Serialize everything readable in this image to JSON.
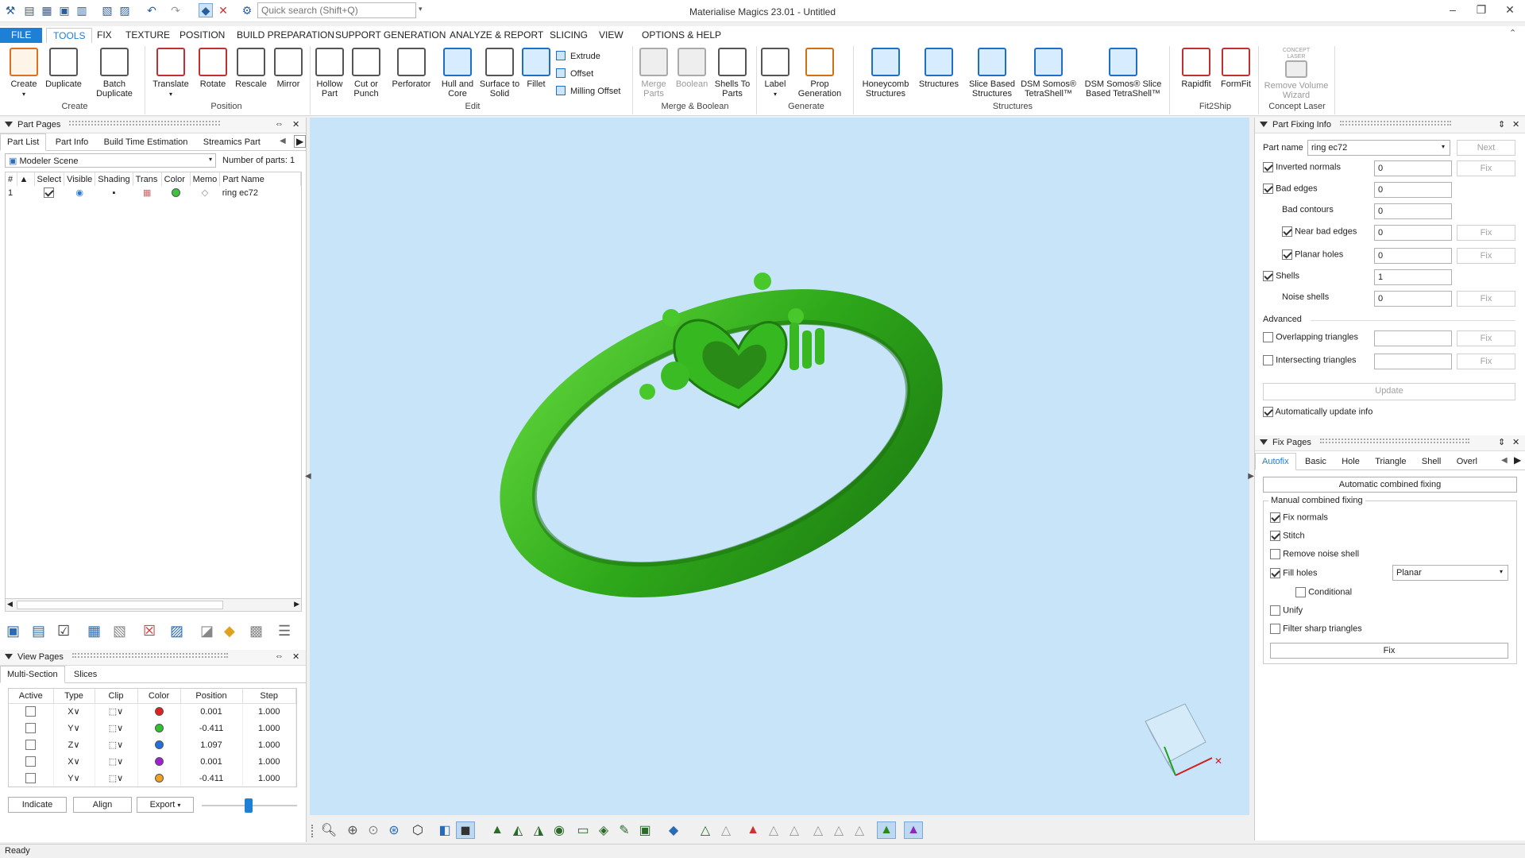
{
  "window": {
    "title": "Materialise Magics 23.01 - Untitled",
    "search_placeholder": "Quick search (Shift+Q)"
  },
  "menu": [
    "FILE",
    "TOOLS",
    "FIX",
    "TEXTURE",
    "POSITION",
    "BUILD PREPARATION",
    "SUPPORT GENERATION",
    "ANALYZE & REPORT",
    "SLICING",
    "VIEW",
    "OPTIONS & HELP"
  ],
  "ribbon": {
    "create": {
      "create": "Create",
      "duplicate": "Duplicate",
      "batch1": "Batch",
      "batch2": "Duplicate",
      "group": "Create"
    },
    "position": {
      "translate": "Translate",
      "rotate": "Rotate",
      "rescale": "Rescale",
      "mirror": "Mirror",
      "group": "Position"
    },
    "edit": {
      "hollow1": "Hollow",
      "hollow2": "Part",
      "cut1": "Cut or",
      "cut2": "Punch",
      "perforator": "Perforator",
      "hull1": "Hull and",
      "hull2": "Core",
      "surf1": "Surface to",
      "surf2": "Solid",
      "fillet": "Fillet",
      "extrude": "Extrude",
      "offset": "Offset",
      "milling": "Milling Offset",
      "group": "Edit"
    },
    "merge": {
      "merge1": "Merge",
      "merge2": "Parts",
      "boolean": "Boolean",
      "shells1": "Shells To",
      "shells2": "Parts",
      "group": "Merge & Boolean"
    },
    "generate": {
      "label": "Label",
      "prop1": "Prop",
      "prop2": "Generation",
      "group": "Generate"
    },
    "structures": {
      "honey1": "Honeycomb",
      "honey2": "Structures",
      "structures": "Structures",
      "slice1": "Slice Based",
      "slice2": "Structures",
      "dsm1": "DSM Somos®",
      "dsm2": "TetraShell™",
      "dsms1": "DSM Somos® Slice",
      "dsms2": "Based TetraShell™",
      "group": "Structures"
    },
    "fit": {
      "rapidfit": "Rapidfit",
      "formfit": "FormFit",
      "group": "Fit2Ship"
    },
    "laser": {
      "icon1": "CONCEPT",
      "icon2": "LASER",
      "rv1": "Remove Volume",
      "rv2": "Wizard",
      "group": "Concept Laser"
    }
  },
  "part_pages": {
    "title": "Part Pages",
    "tabs": [
      "Part List",
      "Part Info",
      "Build Time Estimation",
      "Streamics Part"
    ],
    "scene": "Modeler Scene",
    "count_label": "Number of parts:",
    "count": "1",
    "columns": [
      "#",
      "Select",
      "Visible",
      "Shading",
      "Trans",
      "Color",
      "Memo",
      "Part Name"
    ],
    "rows": [
      {
        "num": "1",
        "select": true,
        "color": "#3cc43c",
        "name": "ring ec72"
      }
    ]
  },
  "view_pages": {
    "title": "View Pages",
    "tabs": [
      "Multi-Section",
      "Slices"
    ],
    "columns": [
      "Active",
      "Type",
      "Clip",
      "Color",
      "Position",
      "Step"
    ],
    "rows": [
      {
        "type": "X",
        "color": "#e02020",
        "position": "0.001",
        "step": "1.000"
      },
      {
        "type": "Y",
        "color": "#30c030",
        "position": "-0.411",
        "step": "1.000"
      },
      {
        "type": "Z",
        "color": "#2070e0",
        "position": "1.097",
        "step": "1.000"
      },
      {
        "type": "X",
        "color": "#a020d0",
        "position": "0.001",
        "step": "1.000"
      },
      {
        "type": "Y",
        "color": "#f0a020",
        "position": "-0.411",
        "step": "1.000"
      }
    ],
    "buttons": {
      "indicate": "Indicate",
      "align": "Align",
      "export": "Export"
    }
  },
  "part_fixing": {
    "title": "Part Fixing Info",
    "part_name_label": "Part name",
    "part_name": "ring ec72",
    "next": "Next",
    "fix": "Fix",
    "inverted_normals": {
      "label": "Inverted normals",
      "value": "0"
    },
    "bad_edges": {
      "label": "Bad edges",
      "value": "0"
    },
    "bad_contours": {
      "label": "Bad contours",
      "value": "0"
    },
    "near_bad_edges": {
      "label": "Near bad edges",
      "value": "0"
    },
    "planar_holes": {
      "label": "Planar holes",
      "value": "0"
    },
    "shells": {
      "label": "Shells",
      "value": "1"
    },
    "noise_shells": {
      "label": "Noise shells",
      "value": "0"
    },
    "advanced": "Advanced",
    "overlapping": "Overlapping triangles",
    "intersecting": "Intersecting triangles",
    "update": "Update",
    "auto_update": "Automatically update info"
  },
  "fix_pages": {
    "title": "Fix Pages",
    "tabs": [
      "Autofix",
      "Basic",
      "Hole",
      "Triangle",
      "Shell",
      "Overl"
    ],
    "auto_combined": "Automatic combined fixing",
    "manual_title": "Manual combined fixing",
    "fix_normals": "Fix normals",
    "stitch": "Stitch",
    "remove_noise": "Remove noise shell",
    "fill_holes": "Fill holes",
    "fill_mode": "Planar",
    "conditional": "Conditional",
    "unify": "Unify",
    "filter_sharp": "Filter sharp triangles",
    "fix": "Fix"
  },
  "status": "Ready",
  "colors": {
    "accent": "#1e7fd7",
    "viewport_bg": "#c7e4f9",
    "ring": "#34b81e"
  }
}
